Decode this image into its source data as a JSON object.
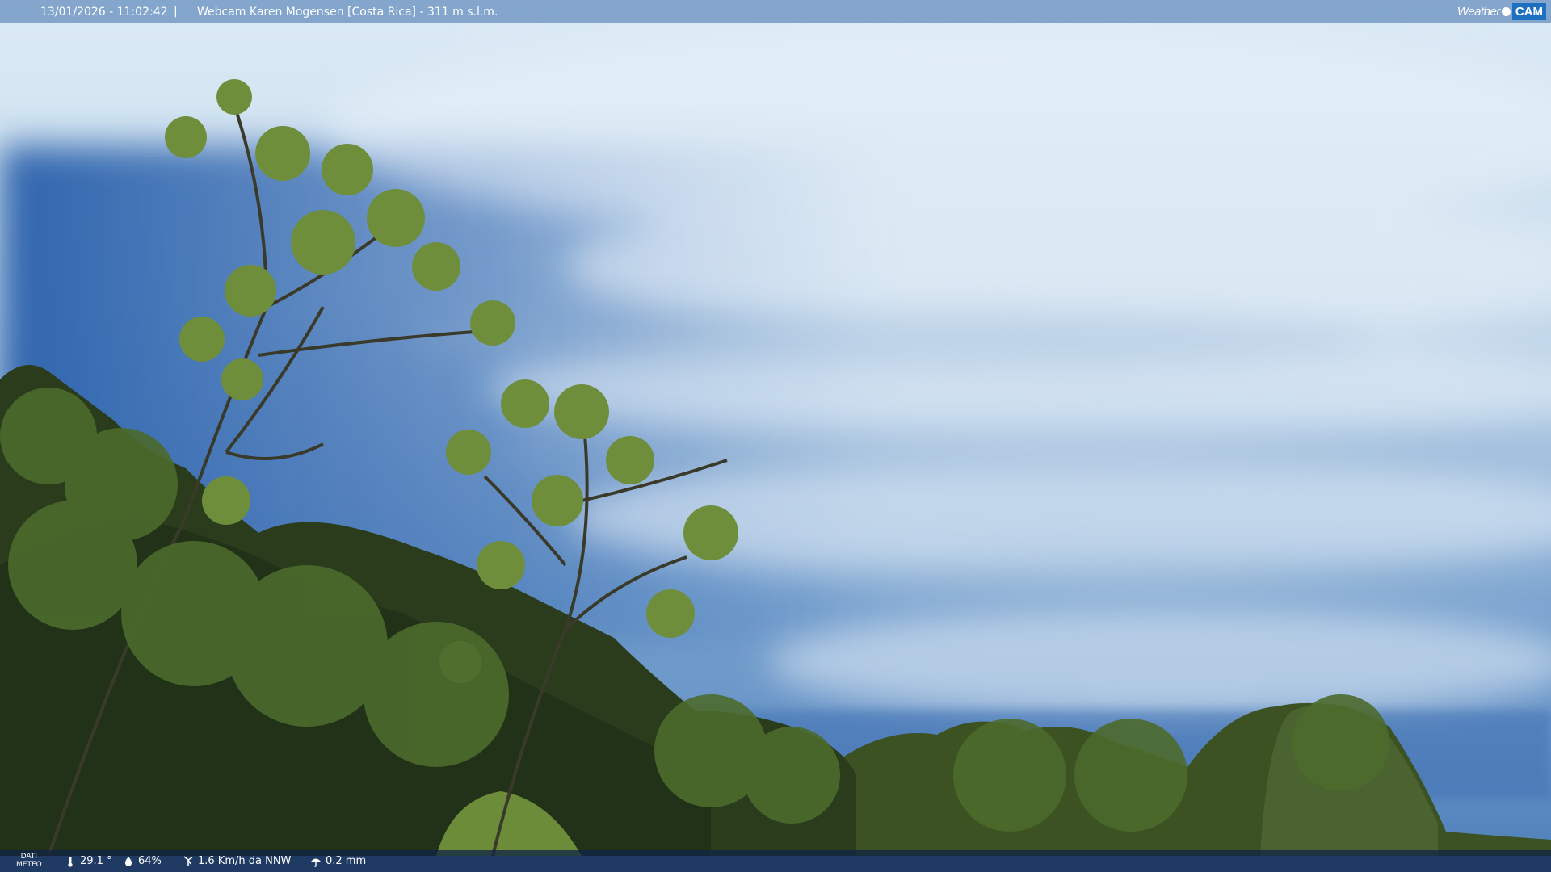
{
  "header": {
    "timestamp": "13/01/2026 - 11:02:42",
    "separator": "|",
    "webcam_title": "Webcam Karen Mogensen [Costa Rica] - 311 m s.l.m."
  },
  "logo": {
    "weather": "Weather",
    "cam": "CAM"
  },
  "footer": {
    "dati_line1": "DATI",
    "dati_line2": "METEO",
    "temperature": "29.1 °",
    "humidity": "64%",
    "wind": "1.6 Km/h da NNW",
    "rain": "0.2 mm"
  },
  "colors": {
    "sky_top": "#d9ecf8",
    "sky_blue": "#2f64ad",
    "foliage": "#24361a"
  },
  "icons": [
    "thermometer-icon",
    "humidity-icon",
    "wind-icon",
    "rain-icon"
  ]
}
